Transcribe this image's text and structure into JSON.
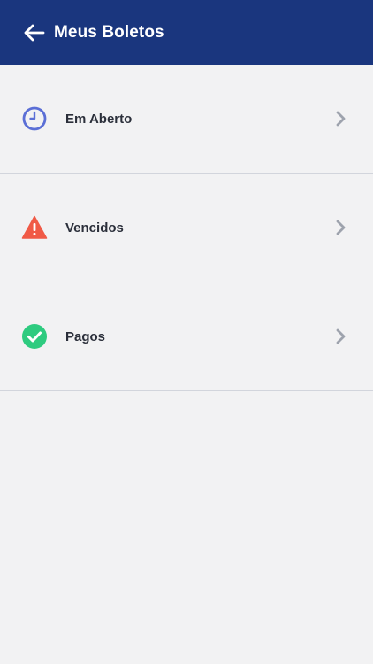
{
  "header": {
    "title": "Meus Boletos",
    "background": "#1a367e",
    "back_icon": "arrow-left-icon"
  },
  "items": [
    {
      "label": "Em Aberto",
      "icon": "clock-icon",
      "color": "#5b6fd6"
    },
    {
      "label": "Vencidos",
      "icon": "warning-icon",
      "color": "#f05a46"
    },
    {
      "label": "Pagos",
      "icon": "check-circle-icon",
      "color": "#2ecb7f"
    }
  ],
  "colors": {
    "background": "#f2f2f3",
    "divider": "#d2d5dc",
    "chevron": "#9ea3ad",
    "text": "#2b2f3a"
  }
}
